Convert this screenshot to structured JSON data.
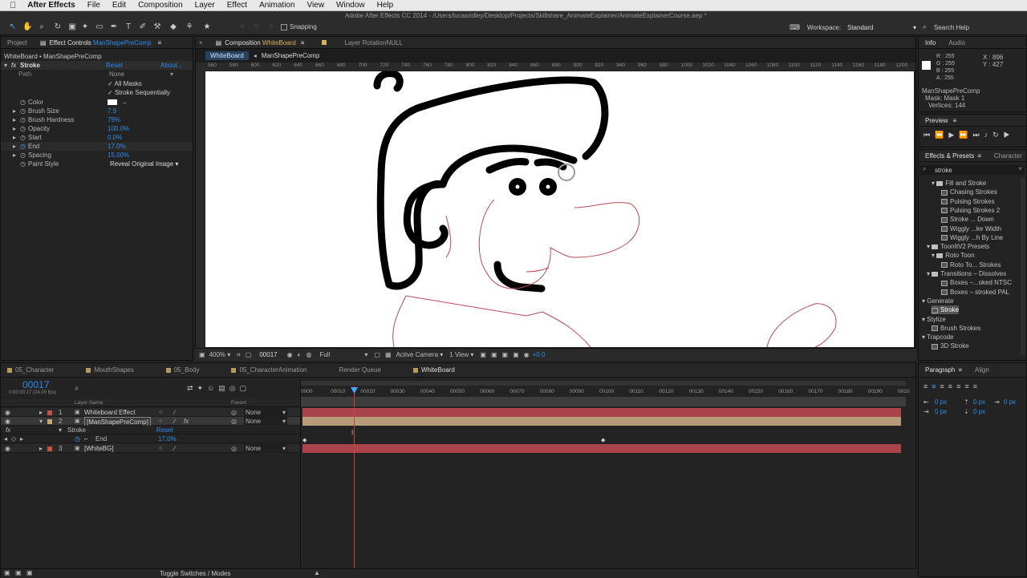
{
  "menubar": {
    "app": "After Effects",
    "items": [
      "File",
      "Edit",
      "Composition",
      "Layer",
      "Effect",
      "Animation",
      "View",
      "Window",
      "Help"
    ]
  },
  "window_title": "Adobe After Effects CC 2014 - /Users/lucasridley/Desktop/Projects/Skillshare_AnimateExplainer/AnimateExplainerCourse.aep *",
  "toolbar": {
    "snapping": "Snapping",
    "workspace_label": "Workspace:",
    "workspace_value": "Standard",
    "search_help": "Search Help"
  },
  "left_panel": {
    "tab_project": "Project",
    "tab_effect_controls": "Effect Controls",
    "tab_effect_layer": "ManShapePreComp",
    "breadcrumb": "WhiteBoard • ManShapePreComp",
    "effect_name": "Stroke",
    "reset": "Reset",
    "about": "About...",
    "path_label": "Path",
    "path_value": "None",
    "all_masks": "All Masks",
    "stroke_seq": "Stroke Sequentially",
    "props": [
      {
        "label": "Color",
        "value": ""
      },
      {
        "label": "Brush Size",
        "value": "7.9"
      },
      {
        "label": "Brush Hardness",
        "value": "79%"
      },
      {
        "label": "Opacity",
        "value": "100.0%"
      },
      {
        "label": "Start",
        "value": "0.0%"
      },
      {
        "label": "End",
        "value": "17.0%"
      },
      {
        "label": "Spacing",
        "value": "15.00%"
      },
      {
        "label": "Paint Style",
        "value": "Reveal Original Image"
      }
    ]
  },
  "comp_panel": {
    "tab_comp": "Composition",
    "tab_comp_name": "WhiteBoard",
    "tab_layer": "Layer RotationNULL",
    "crumb1": "WhiteBoard",
    "crumb2": "ManShapePreComp",
    "ruler_ticks": [
      "560",
      "580",
      "600",
      "620",
      "640",
      "660",
      "680",
      "700",
      "720",
      "740",
      "760",
      "780",
      "800",
      "820",
      "840",
      "860",
      "880",
      "900",
      "920",
      "940",
      "960",
      "980",
      "1000",
      "1020",
      "1040",
      "1060",
      "1080",
      "1100",
      "1120",
      "1140",
      "1160",
      "1180",
      "1200"
    ],
    "viewer_bar": {
      "zoom": "400%",
      "timecode": "00017",
      "resolution": "Full",
      "camera": "Active Camera",
      "views": "1 View",
      "exposure": "+0.0"
    }
  },
  "info_panel": {
    "tab_info": "Info",
    "tab_audio": "Audio",
    "r": "R : 255",
    "g": "G : 255",
    "b": "B : 255",
    "a": "A : 255",
    "x": "X : 896",
    "y": "Y : 427",
    "layer": "ManShapePreComp",
    "mask": "Mask: Mask 1",
    "vertices": "Vertices: 144"
  },
  "preview_panel": {
    "title": "Preview"
  },
  "effects_panel": {
    "tab_effects": "Effects & Presets",
    "tab_character": "Character",
    "search_value": "stroke",
    "items": [
      {
        "label": "Fill and Stroke",
        "type": "folder",
        "indent": 2
      },
      {
        "label": "Chasing Strokes",
        "type": "preset",
        "indent": 4
      },
      {
        "label": "Pulsing Strokes",
        "type": "preset",
        "indent": 4
      },
      {
        "label": "Pulsing Strokes 2",
        "type": "preset",
        "indent": 4
      },
      {
        "label": "Stroke ... Down",
        "type": "preset",
        "indent": 4
      },
      {
        "label": "Wiggly ...ke Width",
        "type": "preset",
        "indent": 4
      },
      {
        "label": "Wiggly ...h By Line",
        "type": "preset",
        "indent": 4
      },
      {
        "label": "ToonItV2 Presets",
        "type": "folder",
        "indent": 1
      },
      {
        "label": "Roto Toon",
        "type": "folder",
        "indent": 2
      },
      {
        "label": "Roto To... Strokes",
        "type": "preset",
        "indent": 4
      },
      {
        "label": "Transitions – Dissolves",
        "type": "folder",
        "indent": 1
      },
      {
        "label": "Boxes –...oked NTSC",
        "type": "preset",
        "indent": 4
      },
      {
        "label": "Boxes – stroked PAL",
        "type": "preset",
        "indent": 4
      },
      {
        "label": "Generate",
        "type": "category",
        "indent": 0
      },
      {
        "label": "Stroke",
        "type": "effect",
        "indent": 2
      },
      {
        "label": "Stylize",
        "type": "category",
        "indent": 0
      },
      {
        "label": "Brush Strokes",
        "type": "effect",
        "indent": 2
      },
      {
        "label": "Trapcode",
        "type": "category",
        "indent": 0
      },
      {
        "label": "3D Stroke",
        "type": "effect",
        "indent": 2
      }
    ]
  },
  "timeline": {
    "tabs": [
      {
        "label": "05_Character",
        "color": "#b79a5c"
      },
      {
        "label": "MouthShapes",
        "color": "#b79a5c"
      },
      {
        "label": "05_Body",
        "color": "#b79a5c"
      },
      {
        "label": "05_CharacterAnimation",
        "color": "#b79a5c"
      },
      {
        "label": "Render Queue",
        "color": ""
      },
      {
        "label": "WhiteBoard",
        "color": "#b79a5c"
      }
    ],
    "timecode": "00017",
    "timecode_sub": "0:00:00:17 (24.00 fps)",
    "header_layer_name": "Layer Name",
    "header_parent": "Parent",
    "layers": [
      {
        "num": "1",
        "name": "Whiteboard Effect",
        "parent": "None",
        "color": "#c8504a"
      },
      {
        "num": "2",
        "name": "[ManShapePreComp]",
        "parent": "None",
        "color": "#c8a870"
      },
      {
        "num": "3",
        "name": "[WhiteBG]",
        "parent": "None",
        "color": "#c8504a"
      }
    ],
    "stroke_label": "Stroke",
    "stroke_reset": "Reset",
    "end_label": "End",
    "end_value": "17.0%",
    "ruler_ticks": [
      "0000",
      "00010",
      "00020",
      "00030",
      "00040",
      "00050",
      "00060",
      "00070",
      "00080",
      "00090",
      "00100",
      "00110",
      "00120",
      "00130",
      "00140",
      "00150",
      "00160",
      "00170",
      "00180",
      "00190",
      "0020"
    ],
    "footer": "Toggle Switches / Modes"
  },
  "paragraph_panel": {
    "tab_paragraph": "Paragraph",
    "tab_align": "Align",
    "values": [
      "0 px",
      "0 px",
      "0 px",
      "0 px",
      "0 px"
    ]
  }
}
